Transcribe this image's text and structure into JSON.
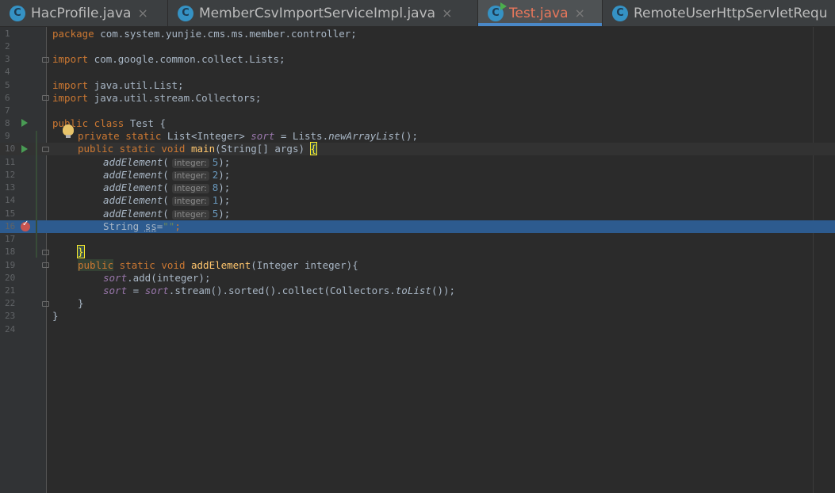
{
  "tabs": [
    {
      "name": "HacProfile.java",
      "icon": "class-icon",
      "icon_letter": "C",
      "close": "×",
      "active": false
    },
    {
      "name": "MemberCsvImportServiceImpl.java",
      "icon": "class-icon",
      "icon_letter": "C",
      "close": "×",
      "active": false
    },
    {
      "name": "Test.java",
      "icon": "runnable-class-icon",
      "icon_letter": "C",
      "close": "×",
      "active": true
    },
    {
      "name": "RemoteUserHttpServletRequ",
      "icon": "class-icon",
      "icon_letter": "C",
      "close": "",
      "active": false
    }
  ],
  "editor": {
    "line_numbers": [
      "1",
      "2",
      "3",
      "4",
      "5",
      "6",
      "7",
      "8",
      "9",
      "10",
      "11",
      "12",
      "13",
      "14",
      "15",
      "16",
      "17",
      "18",
      "19",
      "20",
      "21",
      "22",
      "23",
      "24"
    ],
    "current_line": 10,
    "breakpoint_line": 16,
    "code": {
      "l1": {
        "kw": "package",
        "rest": " com.system.yunjie.cms.ms.member.controller;"
      },
      "l3": {
        "kw": "import",
        "rest": " com.google.common.collect.Lists;"
      },
      "l5": {
        "kw": "import",
        "rest": " java.util.List;"
      },
      "l6": {
        "kw": "import",
        "rest": " java.util.stream.Collectors;"
      },
      "l8": {
        "kw": "public class",
        "rest": " Test {"
      },
      "l9": {
        "kw": "private static",
        "type": " List<Integer> ",
        "field": "sort",
        "eq": " = Lists.",
        "call": "newArrayList",
        "end": "();"
      },
      "l10": {
        "kw": "public static void",
        "sp": " ",
        "fn": "main",
        "args": "(String[] args) ",
        "brace": "{"
      },
      "add_calls": [
        {
          "call": "addElement",
          "open": "(",
          "hint": "integer:",
          "num": "5",
          "close": ");"
        },
        {
          "call": "addElement",
          "open": "(",
          "hint": "integer:",
          "num": "2",
          "close": ");"
        },
        {
          "call": "addElement",
          "open": "(",
          "hint": "integer:",
          "num": "8",
          "close": ");"
        },
        {
          "call": "addElement",
          "open": "(",
          "hint": "integer:",
          "num": "1",
          "close": ");"
        },
        {
          "call": "addElement",
          "open": "(",
          "hint": "integer:",
          "num": "5",
          "close": ");"
        }
      ],
      "l16": {
        "type": "String ",
        "var": "ss",
        "eq": "=",
        "str": "\"\"",
        "end": ";"
      },
      "l18": {
        "brace": "}"
      },
      "l19": {
        "kw1": "public",
        "kw2": " static void ",
        "fn": "addElement",
        "args": "(Integer integer){"
      },
      "l20": {
        "field": "sort",
        "rest": ".add(integer);"
      },
      "l21": {
        "field": "sort",
        "eq": " = ",
        "field2": "sort",
        "rest": ".stream().sorted().collect(Collectors.",
        "call": "toList",
        "end": "());"
      },
      "l22": {
        "brace": "}"
      },
      "l23": {
        "brace": "}"
      }
    }
  },
  "colors": {
    "accent": "#4a88c7",
    "breakpoint_line": "#2d5b8f",
    "active_tab_text": "#e8775b"
  }
}
